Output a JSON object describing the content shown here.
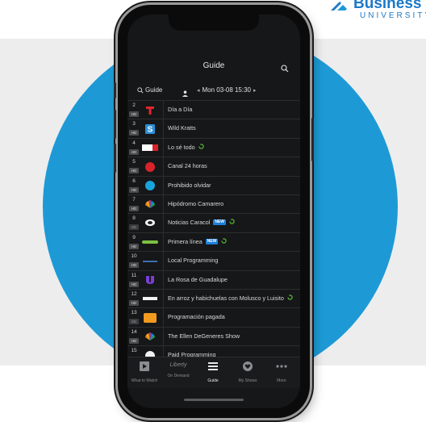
{
  "brand": {
    "logo_line1": "Business",
    "logo_line2": "UNIVERSITY",
    "accent": "#1d9ad6"
  },
  "header": {
    "title": "Guide",
    "guide_link": "Guide",
    "date": "Mon 03-08 15:30",
    "search_icon": "search-icon"
  },
  "channels": [
    {
      "num": "2",
      "hd": "HD",
      "logo": "telemundo",
      "program": "Día a Día"
    },
    {
      "num": "3",
      "hd": "HD",
      "logo": "s",
      "program": "Wild Kratts"
    },
    {
      "num": "4",
      "hd": "HD",
      "logo": "wapa",
      "program": "Lo sé todo",
      "replay": true
    },
    {
      "num": "5",
      "hd": "HD",
      "logo": "24h",
      "program": "Canal 24 horas"
    },
    {
      "num": "6",
      "hd": "HD",
      "logo": "tve",
      "program": "Prohibido olvidar"
    },
    {
      "num": "7",
      "hd": "HD",
      "logo": "nbc",
      "program": "Hipódromo Camarero"
    },
    {
      "num": "8",
      "hd": "SD",
      "logo": "caracol",
      "program": "Noticias Caracol",
      "new": "NEW",
      "replay": true
    },
    {
      "num": "9",
      "hd": "HD",
      "logo": "mundo",
      "program": "Primera línea",
      "new": "NEW",
      "replay": true
    },
    {
      "num": "10",
      "hd": "HD",
      "logo": "local",
      "program": "Local Programming"
    },
    {
      "num": "11",
      "hd": "HD",
      "logo": "univision",
      "program": "La Rosa de Guadalupe"
    },
    {
      "num": "12",
      "hd": "HD",
      "logo": "mega",
      "program": "En arroz y habichuelas con Molusco y Luisito",
      "replay": true
    },
    {
      "num": "13",
      "hd": "SD",
      "logo": "13",
      "program": "Programación pagada"
    },
    {
      "num": "14",
      "hd": "HD",
      "logo": "nbc",
      "program": "The Ellen DeGeneres Show"
    },
    {
      "num": "15",
      "hd": "HD",
      "logo": "abc",
      "program": "Paid Programming"
    }
  ],
  "tabs": [
    {
      "label": "What to Watch",
      "icon": "play-icon"
    },
    {
      "label": "On Demand",
      "icon": "liberty-logo"
    },
    {
      "label": "Guide",
      "icon": "guide-list-icon",
      "active": true
    },
    {
      "label": "My Shows",
      "icon": "heart-icon"
    },
    {
      "label": "More",
      "icon": "more-dots-icon"
    }
  ],
  "tab_brand": "Liberty"
}
